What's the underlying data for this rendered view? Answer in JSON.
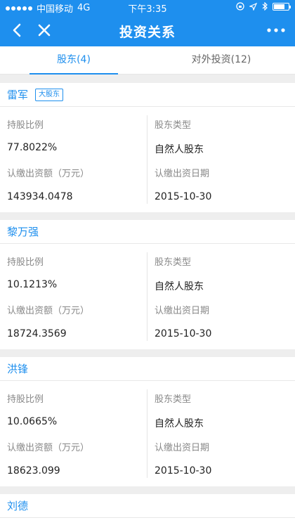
{
  "status_bar": {
    "carrier": "中国移动",
    "network": "4G",
    "time": "下午3:35"
  },
  "nav": {
    "title": "投资关系"
  },
  "tabs": [
    {
      "label": "股东(4)",
      "active": true
    },
    {
      "label": "对外投资(12)",
      "active": false
    }
  ],
  "field_labels": {
    "share_ratio": "持股比例",
    "holder_type": "股东类型",
    "subscribed_capital": "认缴出资额（万元）",
    "subscription_date": "认缴出资日期"
  },
  "shareholders": [
    {
      "name": "雷军",
      "badge": "大股东",
      "share_ratio": "77.8022%",
      "holder_type": "自然人股东",
      "subscribed_capital": "143934.0478",
      "subscription_date": "2015-10-30"
    },
    {
      "name": "黎万强",
      "share_ratio": "10.1213%",
      "holder_type": "自然人股东",
      "subscribed_capital": "18724.3569",
      "subscription_date": "2015-10-30"
    },
    {
      "name": "洪锋",
      "share_ratio": "10.0665%",
      "holder_type": "自然人股东",
      "subscribed_capital": "18623.099",
      "subscription_date": "2015-10-30"
    },
    {
      "name": "刘德"
    }
  ],
  "colors": {
    "accent": "#1e8fee",
    "background": "#eeeeee"
  }
}
